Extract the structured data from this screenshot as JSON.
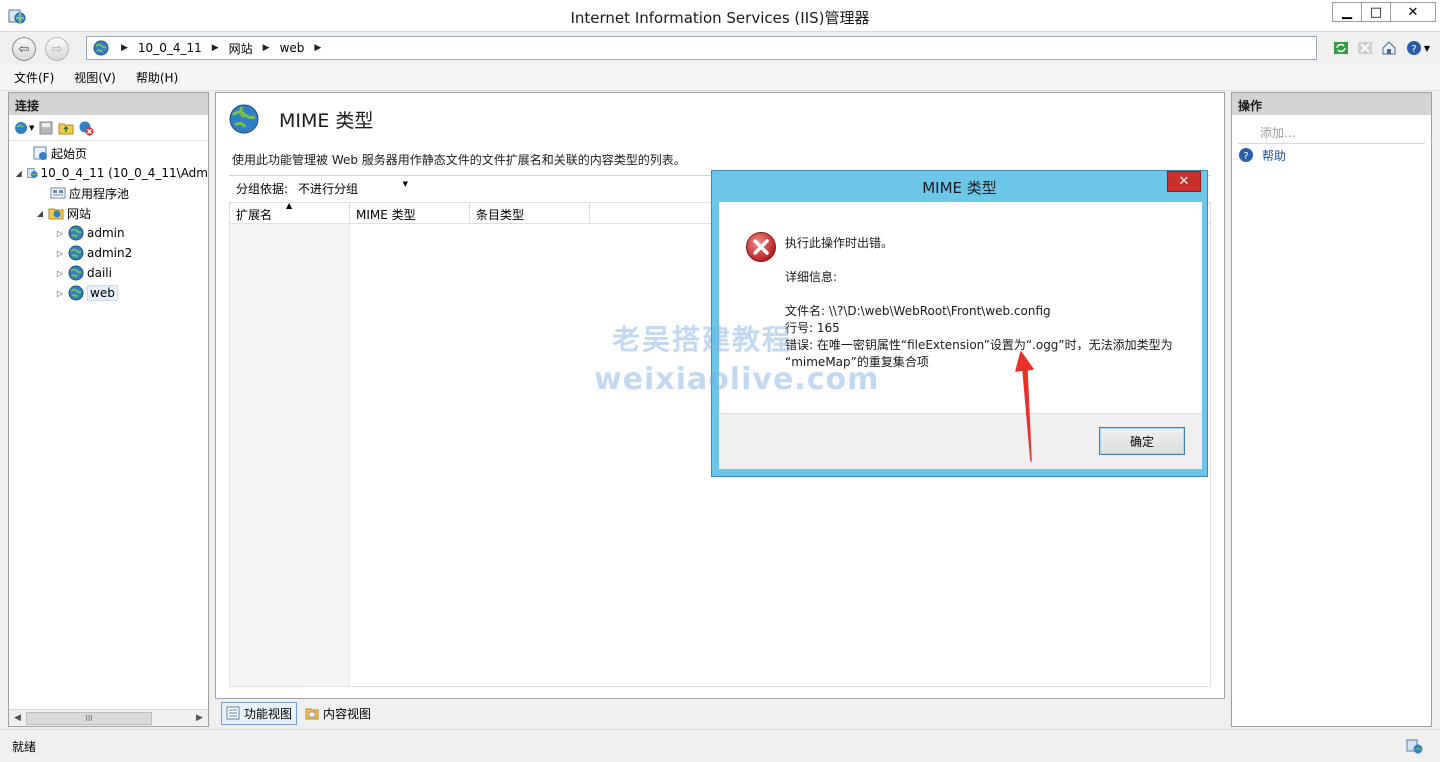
{
  "window": {
    "title": "Internet Information Services (IIS)管理器",
    "controls": {
      "minimize": "▁",
      "maximize": "□",
      "close": "✕"
    }
  },
  "address": {
    "breadcrumbs": [
      "10_0_4_11",
      "网站",
      "web"
    ]
  },
  "menu": [
    "文件(F)",
    "视图(V)",
    "帮助(H)"
  ],
  "connections": {
    "header": "连接",
    "tree": [
      {
        "label": "起始页",
        "level": 0,
        "expander": "",
        "icon": "start-page-icon"
      },
      {
        "label": "10_0_4_11 (10_0_4_11\\Adm",
        "level": 0,
        "expander": "◢",
        "icon": "server-icon"
      },
      {
        "label": "应用程序池",
        "level": 1,
        "expander": "",
        "icon": "app-pool-icon"
      },
      {
        "label": "网站",
        "level": 1,
        "expander": "◢",
        "icon": "sites-folder-icon"
      },
      {
        "label": "admin",
        "level": 2,
        "expander": "▷",
        "icon": "site-globe-icon"
      },
      {
        "label": "admin2",
        "level": 2,
        "expander": "▷",
        "icon": "site-globe-icon"
      },
      {
        "label": "daili",
        "level": 2,
        "expander": "▷",
        "icon": "site-globe-icon"
      },
      {
        "label": "web",
        "level": 2,
        "expander": "▷",
        "icon": "site-globe-icon",
        "selected": true
      }
    ],
    "scroll_thumb": "III"
  },
  "feature": {
    "title": "MIME 类型",
    "description": "使用此功能管理被 Web 服务器用作静态文件的文件扩展名和关联的内容类型的列表。",
    "group_by_label": "分组依据:",
    "group_by_value": "不进行分组",
    "columns": [
      "扩展名",
      "MIME 类型",
      "条目类型"
    ]
  },
  "view_tabs": [
    "功能视图",
    "内容视图"
  ],
  "actions": {
    "header": "操作",
    "add": "添加...",
    "help": "帮助"
  },
  "status": "就绪",
  "dialog": {
    "title": "MIME 类型",
    "close": "✕",
    "message": "执行此操作时出错。",
    "details_label": "详细信息:",
    "filename": "文件名: \\\\?\\D:\\web\\WebRoot\\Front\\web.config",
    "line": "行号: 165",
    "error_line1": "错误: 在唯一密钥属性“fileExtension”设置为“.ogg”时，无法添加类型为",
    "error_line2": "“mimeMap”的重复集合项",
    "ok": "确定"
  },
  "watermark": {
    "line1": "老吴搭建教程",
    "line2": "weixiaolive.com"
  },
  "colors": {
    "dialog_frame": "#6bc6ea",
    "close_red": "#c9302c",
    "annotation_arrow": "#e8312a",
    "help_link": "#1e50a0"
  }
}
